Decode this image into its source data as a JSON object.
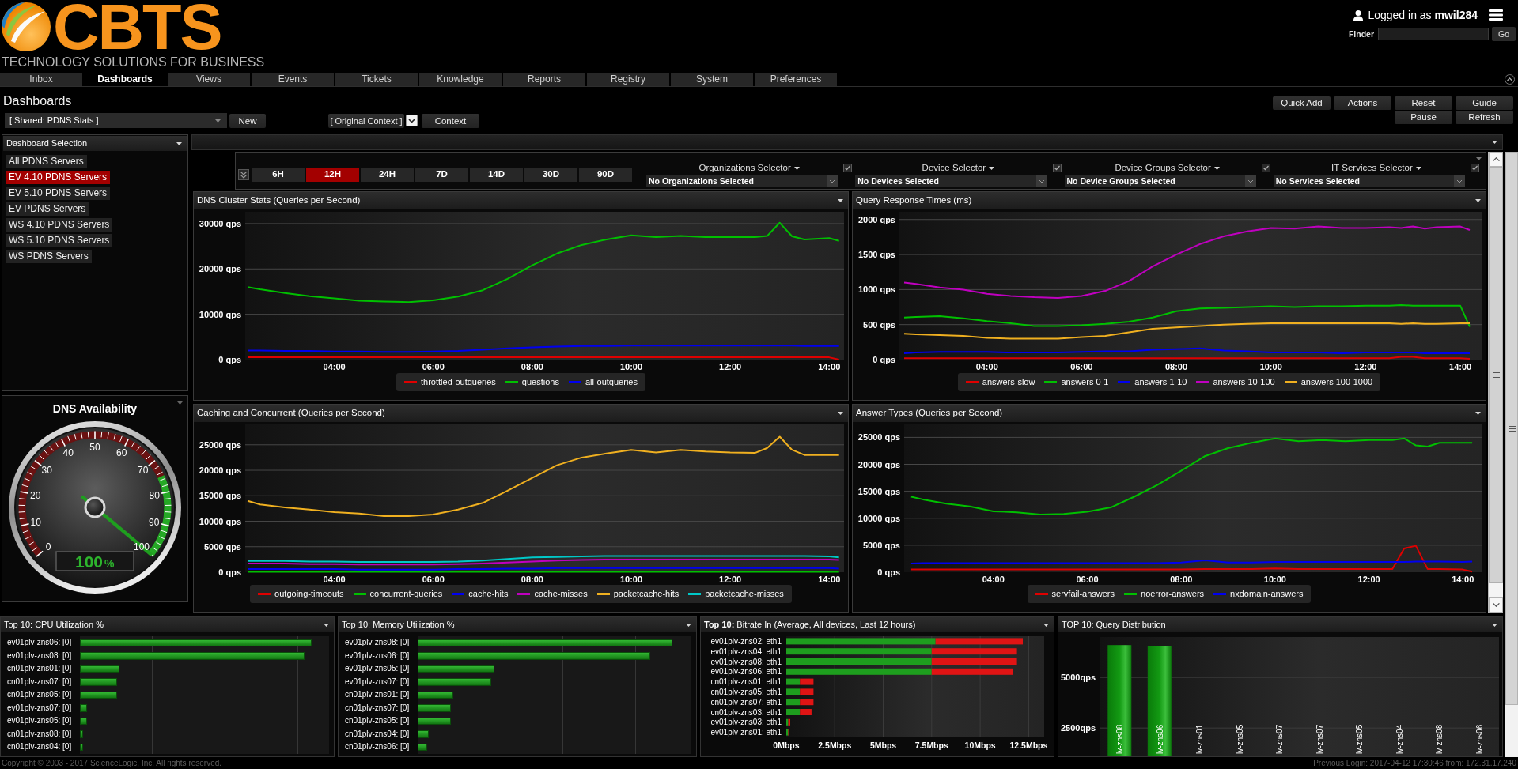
{
  "header": {
    "logo_text": "CBTS",
    "tagline": "TECHNOLOGY SOLUTIONS FOR BUSINESS",
    "login": "Logged in as **mwil284**",
    "finder_label": "Finder",
    "finder_button": "Go"
  },
  "nav_tabs": [
    {
      "label": "Inbox",
      "selected": false
    },
    {
      "label": "Dashboards",
      "selected": true
    },
    {
      "label": "Views",
      "selected": false
    },
    {
      "label": "Events",
      "selected": false
    },
    {
      "label": "Tickets",
      "selected": false
    },
    {
      "label": "Knowledge",
      "selected": false
    },
    {
      "label": "Reports",
      "selected": false
    },
    {
      "label": "Registry",
      "selected": false
    },
    {
      "label": "System",
      "selected": false
    },
    {
      "label": "Preferences",
      "selected": false
    }
  ],
  "toolbar": {
    "title": "Dashboards",
    "dashboard_select": "[ Shared: PDNS Stats ]",
    "new_button": "New",
    "context_select": "[ Original Context ]",
    "context_button": "Context",
    "button_rows": [
      [
        "Quick Add",
        "Actions",
        "Reset",
        "Guide"
      ],
      [
        "Pause",
        "Refresh"
      ]
    ]
  },
  "dashboard_selection": {
    "title": "Dashboard Selection",
    "items": [
      {
        "label": "All PDNS Servers",
        "selected": false
      },
      {
        "label": "EV 4.10 PDNS Servers",
        "selected": true
      },
      {
        "label": "EV 5.10 PDNS Servers",
        "selected": false
      },
      {
        "label": "EV PDNS Servers",
        "selected": false
      },
      {
        "label": "WS 4.10 PDNS Servers",
        "selected": false
      },
      {
        "label": "WS 5.10 PDNS Servers",
        "selected": false
      },
      {
        "label": "WS PDNS Servers",
        "selected": false
      }
    ]
  },
  "availability": {
    "title": "DNS Availability",
    "ticks": [
      "0",
      "10",
      "20",
      "30",
      "40",
      "50",
      "60",
      "70",
      "80",
      "90",
      "100"
    ],
    "level": 1,
    "reading": "100",
    "unit": "%"
  },
  "time_ranges": [
    {
      "label": "6H",
      "selected": false
    },
    {
      "label": "12H",
      "selected": true
    },
    {
      "label": "24H",
      "selected": false
    },
    {
      "label": "7D",
      "selected": false
    },
    {
      "label": "14D",
      "selected": false
    },
    {
      "label": "30D",
      "selected": false
    },
    {
      "label": "90D",
      "selected": false
    }
  ],
  "selectors": [
    {
      "label": "Organizations Selector",
      "value": "No Organizations Selected",
      "checked": true
    },
    {
      "label": "Device Selector",
      "value": "No Devices Selected",
      "checked": true
    },
    {
      "label": "Device Groups Selector",
      "value": "No Device Groups Selected",
      "checked": true
    },
    {
      "label": "IT Services Selector",
      "value": "No Services Selected",
      "checked": true
    }
  ],
  "charts": [
    {
      "title": "DNS Cluster Stats (Queries per Second)",
      "chart_data": {
        "type": "line",
        "grid": true,
        "legend": "bottom",
        "x": [
          2.25,
          2.5,
          3,
          3.5,
          4,
          4.5,
          5,
          5.5,
          6,
          6.5,
          7,
          7.5,
          8,
          8.5,
          9,
          9.5,
          10,
          10.5,
          11,
          11.5,
          12,
          12.5,
          12.75,
          13,
          13.25,
          13.5,
          14,
          14.2
        ],
        "xlim": [
          2.2,
          14.3
        ],
        "ylim": [
          0,
          32600
        ],
        "xticks": [
          {
            "value": 4,
            "label": "04:00"
          },
          {
            "value": 6,
            "label": "06:00"
          },
          {
            "value": 8,
            "label": "08:00"
          },
          {
            "value": 10,
            "label": "10:00"
          },
          {
            "value": 12,
            "label": "12:00"
          },
          {
            "value": 14,
            "label": "14:00"
          }
        ],
        "yticks": [
          {
            "value": 0,
            "label": "0 qps"
          },
          {
            "value": 10000,
            "label": "10000 qps"
          },
          {
            "value": 20000,
            "label": "20000 qps"
          },
          {
            "value": 30000,
            "label": "30000 qps"
          }
        ],
        "series": [
          {
            "name": "throttled-outqueries",
            "color": "#e00000",
            "values": [
              500,
              500,
              500,
              500,
              500,
              500,
              500,
              500,
              500,
              500,
              500,
              500,
              500,
              500,
              500,
              500,
              500,
              500,
              500,
              500,
              500,
              500,
              500,
              500,
              500,
              500,
              500,
              0
            ]
          },
          {
            "name": "questions",
            "color": "#00c000",
            "values": [
              16000,
              15500,
              14700,
              14000,
              13500,
              13000,
              12800,
              12700,
              13100,
              13900,
              15300,
              17800,
              20800,
              23400,
              25300,
              26500,
              27400,
              27000,
              27300,
              27000,
              27000,
              27000,
              27300,
              30200,
              27200,
              26500,
              26800,
              26200
            ]
          },
          {
            "name": "all-outqueries",
            "color": "#0000f0",
            "values": [
              2000,
              2000,
              1900,
              1900,
              1800,
              1800,
              1700,
              1700,
              1800,
              1900,
              2200,
              2500,
              2700,
              2900,
              3000,
              3000,
              3100,
              3100,
              3100,
              3100,
              3100,
              3100,
              3100,
              3100,
              3100,
              3000,
              3000,
              3000
            ]
          }
        ]
      }
    },
    {
      "title": "Query Response Times (ms)",
      "chart_data": {
        "type": "line",
        "grid": true,
        "legend": "bottom",
        "x": [
          2.25,
          2.5,
          3,
          3.5,
          4,
          4.5,
          5,
          5.5,
          6,
          6.5,
          7,
          7.5,
          8,
          8.5,
          9,
          9.5,
          10,
          10.5,
          11,
          11.5,
          12,
          12.5,
          12.75,
          13,
          13.25,
          13.5,
          14,
          14.2
        ],
        "xlim": [
          2.15,
          14.45
        ],
        "ylim": [
          0,
          2110
        ],
        "xticks": [
          {
            "value": 4,
            "label": "04:00"
          },
          {
            "value": 6,
            "label": "06:00"
          },
          {
            "value": 8,
            "label": "08:00"
          },
          {
            "value": 10,
            "label": "10:00"
          },
          {
            "value": 12,
            "label": "12:00"
          },
          {
            "value": 14,
            "label": "14:00"
          }
        ],
        "yticks": [
          {
            "value": 0,
            "label": "0 qps"
          },
          {
            "value": 500,
            "label": "500 qps"
          },
          {
            "value": 1000,
            "label": "1000 qps"
          },
          {
            "value": 1500,
            "label": "1500 qps"
          },
          {
            "value": 2000,
            "label": "2000 qps"
          }
        ],
        "series": [
          {
            "name": "answers-slow",
            "color": "#e00000",
            "values": [
              20,
              20,
              20,
              20,
              20,
              20,
              20,
              20,
              20,
              20,
              20,
              20,
              20,
              20,
              20,
              20,
              20,
              20,
              20,
              20,
              20,
              20,
              40,
              40,
              20,
              20,
              20,
              10
            ]
          },
          {
            "name": "answers 0-1",
            "color": "#00c000",
            "values": [
              600,
              610,
              620,
              590,
              550,
              520,
              480,
              480,
              490,
              510,
              540,
              600,
              690,
              730,
              740,
              750,
              760,
              750,
              760,
              760,
              770,
              770,
              780,
              770,
              770,
              770,
              770,
              470
            ]
          },
          {
            "name": "answers 1-10",
            "color": "#0000f0",
            "values": [
              90,
              100,
              110,
              110,
              110,
              100,
              100,
              100,
              110,
              120,
              120,
              140,
              150,
              160,
              130,
              120,
              100,
              100,
              100,
              90,
              100,
              100,
              100,
              100,
              90,
              90,
              90,
              90
            ]
          },
          {
            "name": "answers 10-100",
            "color": "#c000c0",
            "values": [
              1100,
              1080,
              1030,
              1000,
              940,
              910,
              890,
              880,
              910,
              980,
              1120,
              1330,
              1500,
              1650,
              1760,
              1830,
              1880,
              1870,
              1900,
              1880,
              1880,
              1890,
              1880,
              1900,
              1870,
              1890,
              1900,
              1850
            ]
          },
          {
            "name": "answers 100-1000",
            "color": "#f0b020",
            "values": [
              370,
              360,
              350,
              340,
              310,
              300,
              300,
              300,
              320,
              340,
              390,
              440,
              460,
              480,
              500,
              510,
              520,
              520,
              520,
              520,
              520,
              520,
              510,
              520,
              510,
              510,
              520,
              520
            ]
          }
        ]
      }
    },
    {
      "title": "Caching and Concurrent (Queries per Second)",
      "chart_data": {
        "type": "line",
        "grid": true,
        "legend": "bottom",
        "x": [
          2.25,
          2.5,
          3,
          3.5,
          4,
          4.5,
          5,
          5.5,
          6,
          6.5,
          7,
          7.5,
          8,
          8.5,
          9,
          9.5,
          10,
          10.5,
          11,
          11.5,
          12,
          12.5,
          12.75,
          13,
          13.25,
          13.5,
          14,
          14.2
        ],
        "xlim": [
          2.2,
          14.3
        ],
        "ylim": [
          0,
          29000
        ],
        "xticks": [
          {
            "value": 4,
            "label": "04:00"
          },
          {
            "value": 6,
            "label": "06:00"
          },
          {
            "value": 8,
            "label": "08:00"
          },
          {
            "value": 10,
            "label": "10:00"
          },
          {
            "value": 12,
            "label": "12:00"
          },
          {
            "value": 14,
            "label": "14:00"
          }
        ],
        "yticks": [
          {
            "value": 0,
            "label": "0 qps"
          },
          {
            "value": 5000,
            "label": "5000 qps"
          },
          {
            "value": 10000,
            "label": "10000 qps"
          },
          {
            "value": 15000,
            "label": "15000 qps"
          },
          {
            "value": 20000,
            "label": "20000 qps"
          },
          {
            "value": 25000,
            "label": "25000 qps"
          }
        ],
        "series": [
          {
            "name": "outgoing-timeouts",
            "color": "#e00000",
            "values": [
              null,
              null,
              null,
              null,
              null,
              null,
              null,
              null,
              null,
              null,
              null,
              null,
              null,
              null,
              null,
              null,
              null,
              null,
              null,
              null,
              null,
              null,
              null,
              null,
              null,
              null,
              null,
              null
            ]
          },
          {
            "name": "concurrent-queries",
            "color": "#00c000",
            "values": [
              100,
              100,
              100,
              100,
              100,
              100,
              100,
              100,
              100,
              100,
              100,
              100,
              100,
              100,
              100,
              100,
              100,
              100,
              100,
              100,
              100,
              100,
              100,
              100,
              100,
              100,
              100,
              100
            ]
          },
          {
            "name": "cache-hits",
            "color": "#0000f0",
            "values": [
              600,
              600,
              600,
              600,
              600,
              500,
              500,
              500,
              500,
              600,
              600,
              700,
              700,
              800,
              800,
              800,
              800,
              800,
              800,
              800,
              800,
              800,
              800,
              800,
              800,
              800,
              800,
              700
            ]
          },
          {
            "name": "cache-misses",
            "color": "#c000c0",
            "values": [
              1700,
              1700,
              1700,
              1600,
              1600,
              1500,
              1500,
              1500,
              1500,
              1600,
              1700,
              1900,
              2100,
              2300,
              2400,
              2500,
              2500,
              2500,
              2500,
              2500,
              2500,
              2500,
              2500,
              2500,
              2500,
              2500,
              2500,
              2400
            ]
          },
          {
            "name": "packetcache-hits",
            "color": "#f0b020",
            "values": [
              14000,
              13300,
              12700,
              12300,
              11800,
              11500,
              11000,
              11000,
              11300,
              12300,
              13600,
              16000,
              18500,
              21000,
              22500,
              23300,
              24000,
              23500,
              24000,
              23700,
              23500,
              23400,
              24400,
              26600,
              24000,
              23000,
              23000,
              23000
            ]
          },
          {
            "name": "packetcache-misses",
            "color": "#00c8c8",
            "values": [
              2200,
              2200,
              2200,
              2100,
              2100,
              2000,
              2000,
              2000,
              2000,
              2100,
              2300,
              2600,
              2900,
              3000,
              3100,
              3200,
              3200,
              3200,
              3200,
              3200,
              3200,
              3200,
              3200,
              3200,
              3200,
              3200,
              3100,
              2900
            ]
          }
        ]
      }
    },
    {
      "title": "Answer Types (Queries per Second)",
      "chart_data": {
        "type": "line",
        "grid": true,
        "legend": "bottom",
        "x": [
          2.25,
          2.5,
          3,
          3.5,
          4,
          4.5,
          5,
          5.5,
          6,
          6.5,
          7,
          7.5,
          8,
          8.5,
          9,
          9.5,
          10,
          10.5,
          11,
          11.5,
          12,
          12.5,
          12.75,
          13,
          13.25,
          13.5,
          14,
          14.2
        ],
        "xlim": [
          2.1,
          14.4
        ],
        "ylim": [
          0,
          27400
        ],
        "xticks": [
          {
            "value": 4,
            "label": "04:00"
          },
          {
            "value": 6,
            "label": "06:00"
          },
          {
            "value": 8,
            "label": "08:00"
          },
          {
            "value": 10,
            "label": "10:00"
          },
          {
            "value": 12,
            "label": "12:00"
          },
          {
            "value": 14,
            "label": "14:00"
          }
        ],
        "yticks": [
          {
            "value": 0,
            "label": "0 qps"
          },
          {
            "value": 5000,
            "label": "5000 qps"
          },
          {
            "value": 10000,
            "label": "10000 qps"
          },
          {
            "value": 15000,
            "label": "15000 qps"
          },
          {
            "value": 20000,
            "label": "20000 qps"
          },
          {
            "value": 25000,
            "label": "25000 qps"
          }
        ],
        "series": [
          {
            "name": "servfail-answers",
            "color": "#e00000",
            "values": [
              500,
              500,
              500,
              500,
              500,
              500,
              500,
              500,
              500,
              500,
              500,
              500,
              500,
              600,
              600,
              600,
              700,
              600,
              600,
              600,
              600,
              600,
              4400,
              4900,
              600,
              600,
              500,
              100
            ]
          },
          {
            "name": "noerror-answers",
            "color": "#00c000",
            "values": [
              14000,
              13500,
              12700,
              12200,
              11300,
              11100,
              10700,
              10800,
              11200,
              12000,
              14000,
              16200,
              18800,
              21500,
              23000,
              24000,
              24800,
              24300,
              24500,
              24300,
              24500,
              24500,
              24800,
              23500,
              23300,
              24000,
              24000,
              24000
            ]
          },
          {
            "name": "nxdomain-answers",
            "color": "#0000f0",
            "values": [
              1600,
              1700,
              1700,
              1700,
              1700,
              1700,
              1700,
              1700,
              1700,
              1700,
              1700,
              1700,
              1800,
              2200,
              1800,
              1800,
              1900,
              1900,
              1900,
              1900,
              1900,
              1900,
              1900,
              2000,
              2000,
              2000,
              1900,
              2000
            ]
          }
        ]
      }
    }
  ],
  "bottom_panels": [
    {
      "kind": "bars",
      "title": "Top 10: CPU Utilization %",
      "bars": [
        {
          "label": "ev01plv-zns06: [0]",
          "level": 0.93
        },
        {
          "label": "ev01plv-zns08: [0]",
          "level": 0.9
        },
        {
          "label": "cn01plv-zns01: [0]",
          "level": 0.16
        },
        {
          "label": "cn01plv-zns07: [0]",
          "level": 0.15
        },
        {
          "label": "cn01plv-zns05: [0]",
          "level": 0.15
        },
        {
          "label": "ev01plv-zns07: [0]",
          "level": 0.03
        },
        {
          "label": "ev01plv-zns05: [0]",
          "level": 0.03
        },
        {
          "label": "cn01plv-zns08: [0]",
          "level": 0.012
        },
        {
          "label": "cn01plv-zns04: [0]",
          "level": 0.012
        }
      ]
    },
    {
      "kind": "bars",
      "title": "Top 10: Memory Utilization %",
      "bars": [
        {
          "label": "ev01plv-zns08: [0]",
          "level": 0.93
        },
        {
          "label": "ev01plv-zns06: [0]",
          "level": 0.85
        },
        {
          "label": "ev01plv-zns05: [0]",
          "level": 0.28
        },
        {
          "label": "ev01plv-zns07: [0]",
          "level": 0.27
        },
        {
          "label": "cn01plv-zns01: [0]",
          "level": 0.13
        },
        {
          "label": "cn01plv-zns07: [0]",
          "level": 0.12
        },
        {
          "label": "cn01plv-zns05: [0]",
          "level": 0.12
        },
        {
          "label": "cn01plv-zns04: [0]",
          "level": 0.04
        },
        {
          "label": "cn01plv-zns06: [0]",
          "level": 0.035
        }
      ]
    },
    {
      "kind": "chart",
      "title": "**Top 10:** Bitrate In (Average, All devices, Last 12 hours)",
      "chart_data": {
        "type": "bar",
        "orientation": "horizontal",
        "stacked": true,
        "grid": true,
        "categories": [
          "ev01plv-zns02: eth1",
          "ev01plv-zns04: eth1",
          "ev01plv-zns08: eth1",
          "ev01plv-zns06: eth1",
          "cn01plv-zns01: eth1",
          "cn01plv-zns05: eth1",
          "cn01plv-zns07: eth1",
          "cn01plv-zns03: eth1",
          "ev01plv-zns03: eth1",
          "ev01plv-zns01: eth1"
        ],
        "series": [
          {
            "color": "#1e9e1e",
            "values": [
              7.7,
              7.5,
              7.5,
              7.5,
              0.7,
              0.7,
              0.7,
              0.7,
              0.1,
              0.1
            ]
          },
          {
            "color": "#e01414",
            "values": [
              4.5,
              4.4,
              4.4,
              4.2,
              0.7,
              0.7,
              0.7,
              0.6,
              0.1,
              0.05
            ]
          }
        ],
        "xlim": [
          0,
          13.3
        ],
        "xticks": [
          {
            "value": 0,
            "label": "0Mbps"
          },
          {
            "value": 2.5,
            "label": "2.5Mbps"
          },
          {
            "value": 5,
            "label": "5Mbps"
          },
          {
            "value": 7.5,
            "label": "7.5Mbps"
          },
          {
            "value": 10,
            "label": "10Mbps"
          },
          {
            "value": 12.5,
            "label": "12.5Mbps"
          }
        ]
      }
    },
    {
      "kind": "chart",
      "title": "TOP 10: Query Distribution",
      "chart_data": {
        "type": "bar",
        "orientation": "vertical",
        "grid": true,
        "categories": [
          "lv-zns08",
          "lv-zns06",
          "lv-zns01",
          "lv-zns05",
          "lv-zns07",
          "lv-zns07",
          "lv-zns05",
          "lv-zns04",
          "lv-zns08",
          "lv-zns06"
        ],
        "values": [
          6600,
          6550,
          null,
          null,
          null,
          null,
          null,
          null,
          null,
          null
        ],
        "ylim": [
          1100,
          7000
        ],
        "yticks": [
          {
            "value": 2500,
            "label": "2500qps"
          },
          {
            "value": 5000,
            "label": "5000qps"
          }
        ]
      }
    }
  ],
  "footer": {
    "copyright": "Copyright © 2003 - 2017 ScienceLogic, Inc. All rights reserved.",
    "previous_login": "Previous Login: 2017-04-12 17:30:46 from: 172.31.17.240"
  }
}
